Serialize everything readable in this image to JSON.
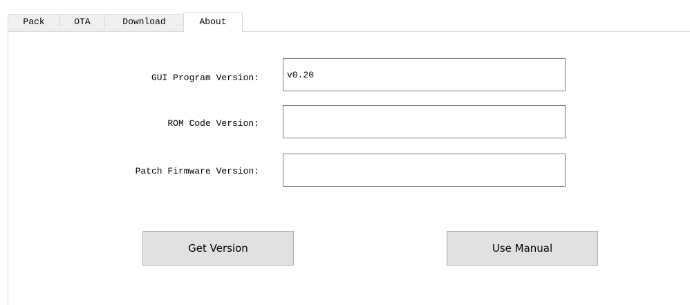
{
  "tabs": [
    {
      "label": "Pack"
    },
    {
      "label": "OTA"
    },
    {
      "label": "Download"
    },
    {
      "label": "About",
      "active": true
    }
  ],
  "about": {
    "gui_version": {
      "label": "GUI Program Version:",
      "value": "v0.20"
    },
    "rom_version": {
      "label": "ROM Code Version:",
      "value": ""
    },
    "patch_version": {
      "label": "Patch Firmware Version:",
      "value": ""
    },
    "get_version_button": "Get Version",
    "use_manual_button": "Use Manual"
  },
  "colors": {
    "tab_bg": "#f0f0f0",
    "active_tab_bg": "#ffffff",
    "button_bg": "#e1e1e1",
    "field_border": "#7a7a7a"
  }
}
